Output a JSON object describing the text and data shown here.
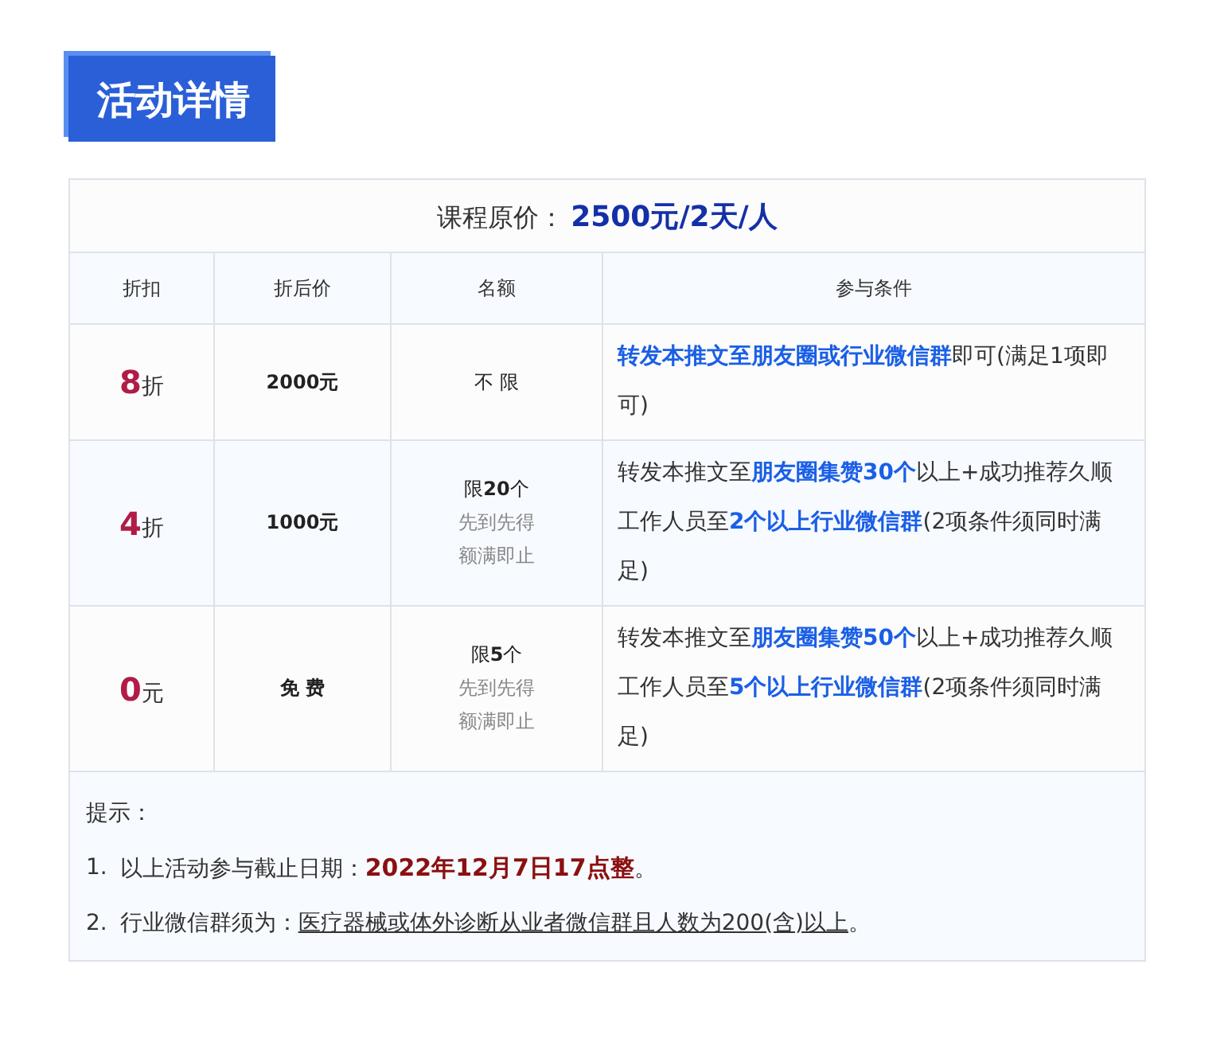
{
  "heading": "活动详情",
  "table": {
    "price_label": "课程原价：",
    "price_value": "2500元/2天/人",
    "columns": [
      "折扣",
      "折后价",
      "名额",
      "参与条件"
    ],
    "rows": [
      {
        "discount": "**8**折",
        "price": "2000元",
        "quota": [
          "不 限"
        ],
        "condition": "**转发本推文至朋友圈或行业微信群**即可(满足1项即可)"
      },
      {
        "discount": "**4**折",
        "price": "1000元",
        "quota": [
          "限**20**个",
          "先到先得",
          "额满即止"
        ],
        "condition": "转发本推文至**朋友圈集赞30个**以上+成功推荐久顺工作人员至**2个以上行业微信群**(2项条件须同时满足)"
      },
      {
        "discount": "**0**元",
        "price": "免 费",
        "quota": [
          "限**5**个",
          "先到先得",
          "额满即止"
        ],
        "condition": "转发本推文至**朋友圈集赞50个**以上+成功推荐久顺工作人员至**5个以上行业微信群**(2项条件须同时满足)"
      }
    ]
  },
  "notes": {
    "title": "提示：",
    "items": [
      {
        "number": "1.",
        "text": "以上活动参与截止日期：**2022年12月7日17点整**。"
      },
      {
        "number": "2.",
        "text": "行业微信群须为：",
        "underlined": "医疗器械或体外诊断从业者微信群且人数为200(含)以上",
        "end": "。"
      }
    ]
  }
}
